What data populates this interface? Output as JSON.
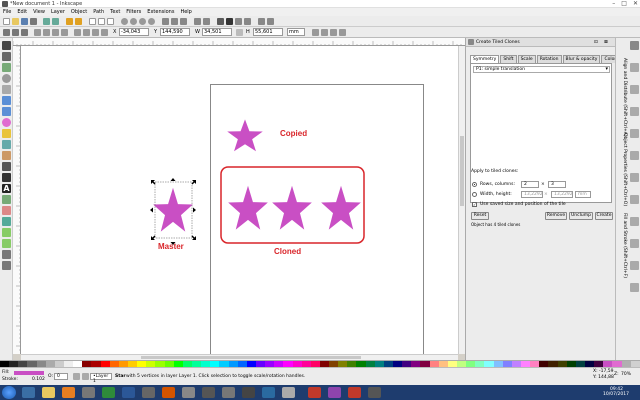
{
  "window": {
    "title": "*New document 1 - Inkscape",
    "controls": [
      "–",
      "□",
      "✕"
    ]
  },
  "menu": [
    "File",
    "Edit",
    "View",
    "Layer",
    "Object",
    "Path",
    "Text",
    "Filters",
    "Extensions",
    "Help"
  ],
  "toolcontrols": {
    "x_label": "X",
    "x_value": "-34,043",
    "y_label": "Y",
    "y_value": "144,590",
    "w_label": "W",
    "w_value": "34,501",
    "h_label": "H",
    "h_value": "55,601",
    "unit": "mm"
  },
  "canvas": {
    "master_label": "Master",
    "copied_label": "Copied",
    "cloned_label": "Cloned",
    "star_color": "#c94fc4",
    "accent_red": "#d9252a"
  },
  "dialog": {
    "title": "Create Tiled Clones",
    "tabs": [
      "Symmetry",
      "Shift",
      "Scale",
      "Rotation",
      "Blur & opacity",
      "Color",
      "Trace"
    ],
    "symmetry_value": "P1: simple translation",
    "apply_label": "Apply to tiled clones:",
    "rows_label": "Rows, columns:",
    "rows_value": "2",
    "cols_value": "3",
    "times": "×",
    "wh_label": "Width, height:",
    "width_value": "13,2292",
    "height_value": "13,2292",
    "wh_unit": "mm",
    "saved_size_label": "Use saved size and position of the tile",
    "reset_label": "Reset",
    "remove_label": "Remove",
    "unclump_label": "Unclump",
    "create_label": "Create",
    "status_msg": "Object has 4 tiled clones"
  },
  "rightdock_tabs": [
    "Fill and Stroke (Shift+Ctrl+F)",
    "Object Properties (Shift+Ctrl+O)",
    "Align and Distribute (Shift+Ctrl+A)"
  ],
  "statusbar": {
    "fill_label": "Fill:",
    "stroke_label": "Stroke:",
    "stroke_value": "0.102",
    "opacity_label": "O:",
    "opacity_value": "0",
    "layer_value": "•Layer 1",
    "message_bold": "Star",
    "message": "with 5 vertices in layer Layer 1. Click selection to toggle scale/rotation handles.",
    "x_coord": "X: -17,59",
    "y_coord": "Y: 144,88",
    "zoom_label": "Z:",
    "zoom_value": "70%"
  },
  "taskbar": {
    "time": "09:42",
    "date": "10/07/2017"
  }
}
